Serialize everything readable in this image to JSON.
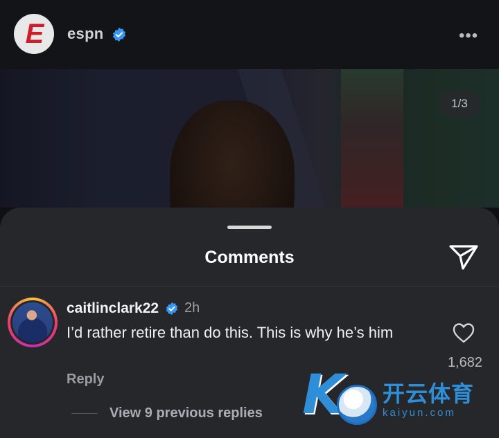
{
  "post_header": {
    "account": "espn",
    "more_icon": "more-horizontal-icon"
  },
  "photo": {
    "counter": "1/3"
  },
  "comments_sheet": {
    "title": "Comments",
    "share_icon": "send-icon"
  },
  "comment": {
    "username": "caitlinclark22",
    "time": "2h",
    "text": "I’d rather retire than do this. This is why he’s him",
    "reply_label": "Reply",
    "like_count": "1,682",
    "view_replies": "View 9 previous replies"
  },
  "watermark": {
    "chinese": "开云体育",
    "url": "kaiyun.com"
  },
  "colors": {
    "verified": "#3897f0",
    "espn_red": "#cc1f2b",
    "sheet_bg": "#25272b"
  }
}
